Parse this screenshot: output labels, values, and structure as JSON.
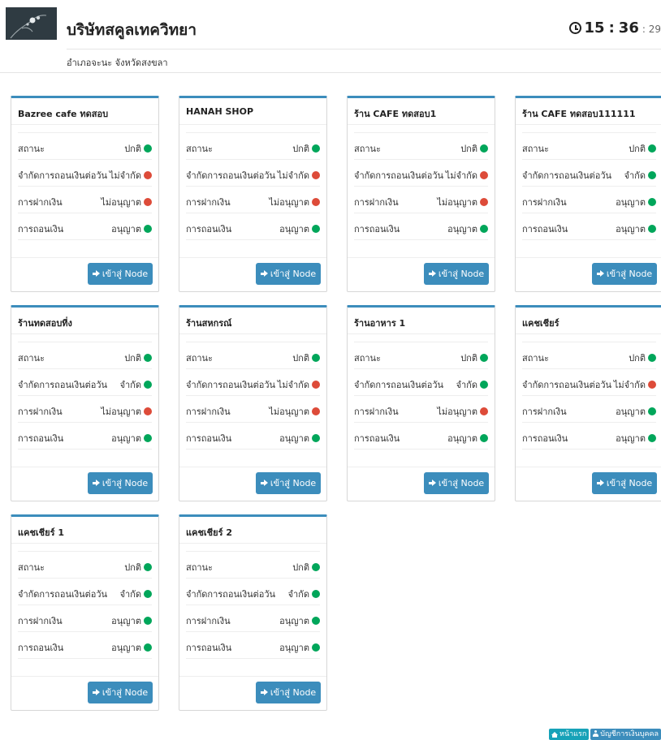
{
  "header": {
    "title": "บริษัทสคูลเทควิทยา",
    "subtitle": "อำเภอจะนะ จังหวัดสงขลา",
    "clock": {
      "hours": "15",
      "minutes": "36",
      "seconds": ": 29"
    }
  },
  "labels": {
    "status": "สถานะ",
    "limit": "จำกัดการถอนเงินต่อวัน",
    "deposit": "การฝากเงิน",
    "withdraw": "การถอนเงิน",
    "enter_button": "เข้าสู่ Node"
  },
  "colors": {
    "ok": "#00a65a",
    "bad": "#dd4b39",
    "accent": "#3c8dbc"
  },
  "cards": [
    {
      "name": "Bazree cafe ทดสอบ",
      "status": "ปกติ",
      "status_ok": true,
      "limit": "ไม่จำกัด",
      "limit_ok": false,
      "deposit": "ไม่อนุญาต",
      "deposit_ok": false,
      "withdraw": "อนุญาต",
      "withdraw_ok": true
    },
    {
      "name": "HANAH SHOP",
      "status": "ปกติ",
      "status_ok": true,
      "limit": "ไม่จำกัด",
      "limit_ok": false,
      "deposit": "ไม่อนุญาต",
      "deposit_ok": false,
      "withdraw": "อนุญาต",
      "withdraw_ok": true
    },
    {
      "name": "ร้าน CAFE ทดสอบ1",
      "status": "ปกติ",
      "status_ok": true,
      "limit": "ไม่จำกัด",
      "limit_ok": false,
      "deposit": "ไม่อนุญาต",
      "deposit_ok": false,
      "withdraw": "อนุญาต",
      "withdraw_ok": true
    },
    {
      "name": "ร้าน CAFE ทดสอบ111111",
      "status": "ปกติ",
      "status_ok": true,
      "limit": "จำกัด",
      "limit_ok": true,
      "deposit": "อนุญาต",
      "deposit_ok": true,
      "withdraw": "อนุญาต",
      "withdraw_ok": true
    },
    {
      "name": "ร้านทดสอบที่ง",
      "status": "ปกติ",
      "status_ok": true,
      "limit": "จำกัด",
      "limit_ok": true,
      "deposit": "ไม่อนุญาต",
      "deposit_ok": false,
      "withdraw": "อนุญาต",
      "withdraw_ok": true
    },
    {
      "name": "ร้านสหกรณ์",
      "status": "ปกติ",
      "status_ok": true,
      "limit": "ไม่จำกัด",
      "limit_ok": false,
      "deposit": "ไม่อนุญาต",
      "deposit_ok": false,
      "withdraw": "อนุญาต",
      "withdraw_ok": true
    },
    {
      "name": "ร้านอาหาร 1",
      "status": "ปกติ",
      "status_ok": true,
      "limit": "จำกัด",
      "limit_ok": true,
      "deposit": "ไม่อนุญาต",
      "deposit_ok": false,
      "withdraw": "อนุญาต",
      "withdraw_ok": true
    },
    {
      "name": "แคชเชียร์",
      "status": "ปกติ",
      "status_ok": true,
      "limit": "ไม่จำกัด",
      "limit_ok": false,
      "deposit": "อนุญาต",
      "deposit_ok": true,
      "withdraw": "อนุญาต",
      "withdraw_ok": true
    },
    {
      "name": "แคชเชียร์ 1",
      "status": "ปกติ",
      "status_ok": true,
      "limit": "จำกัด",
      "limit_ok": true,
      "deposit": "อนุญาต",
      "deposit_ok": true,
      "withdraw": "อนุญาต",
      "withdraw_ok": true
    },
    {
      "name": "แคชเชียร์ 2",
      "status": "ปกติ",
      "status_ok": true,
      "limit": "จำกัด",
      "limit_ok": true,
      "deposit": "อนุญาต",
      "deposit_ok": true,
      "withdraw": "อนุญาต",
      "withdraw_ok": true
    }
  ],
  "footer": {
    "home": "หน้าแรก",
    "accounts": "บัญชีการเงินบุคคล"
  }
}
